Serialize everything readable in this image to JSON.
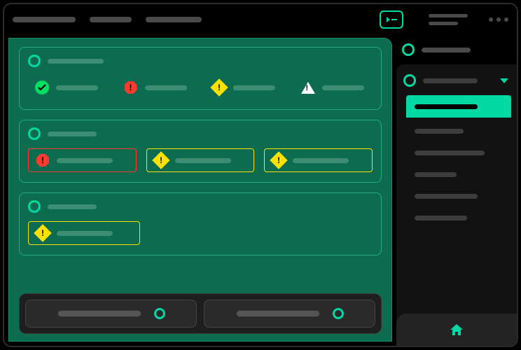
{
  "topbar": {
    "tabs": [
      "",
      "",
      ""
    ],
    "meta_lines": [
      "",
      ""
    ]
  },
  "sections": [
    {
      "title": "",
      "items": [
        {
          "status": "ok",
          "label": "",
          "border": "none"
        },
        {
          "status": "critical",
          "label": "",
          "border": "none"
        },
        {
          "status": "warning",
          "label": "",
          "border": "none"
        },
        {
          "status": "caution",
          "label": "",
          "border": "none"
        }
      ]
    },
    {
      "title": "",
      "items": [
        {
          "status": "critical",
          "label": "",
          "border": "red"
        },
        {
          "status": "warning",
          "label": "",
          "border": "yellow"
        },
        {
          "status": "warning",
          "label": "",
          "border": "yellow"
        }
      ]
    },
    {
      "title": "",
      "items": [
        {
          "status": "warning",
          "label": "",
          "border": "yellow"
        }
      ]
    }
  ],
  "devices": [
    {
      "label": ""
    },
    {
      "label": ""
    }
  ],
  "sidebar": {
    "top_label": "",
    "group_label": "",
    "items": [
      {
        "label": "",
        "active": true
      },
      {
        "label": "",
        "active": false
      },
      {
        "label": "",
        "active": false
      },
      {
        "label": "",
        "active": false
      },
      {
        "label": "",
        "active": false
      },
      {
        "label": "",
        "active": false
      }
    ]
  },
  "colors": {
    "accent": "#00d9a3",
    "panel": "#0d6b4f",
    "ok": "#00e060",
    "critical": "#ff3b30",
    "warning": "#ffe100",
    "caution": "#ffffff"
  }
}
